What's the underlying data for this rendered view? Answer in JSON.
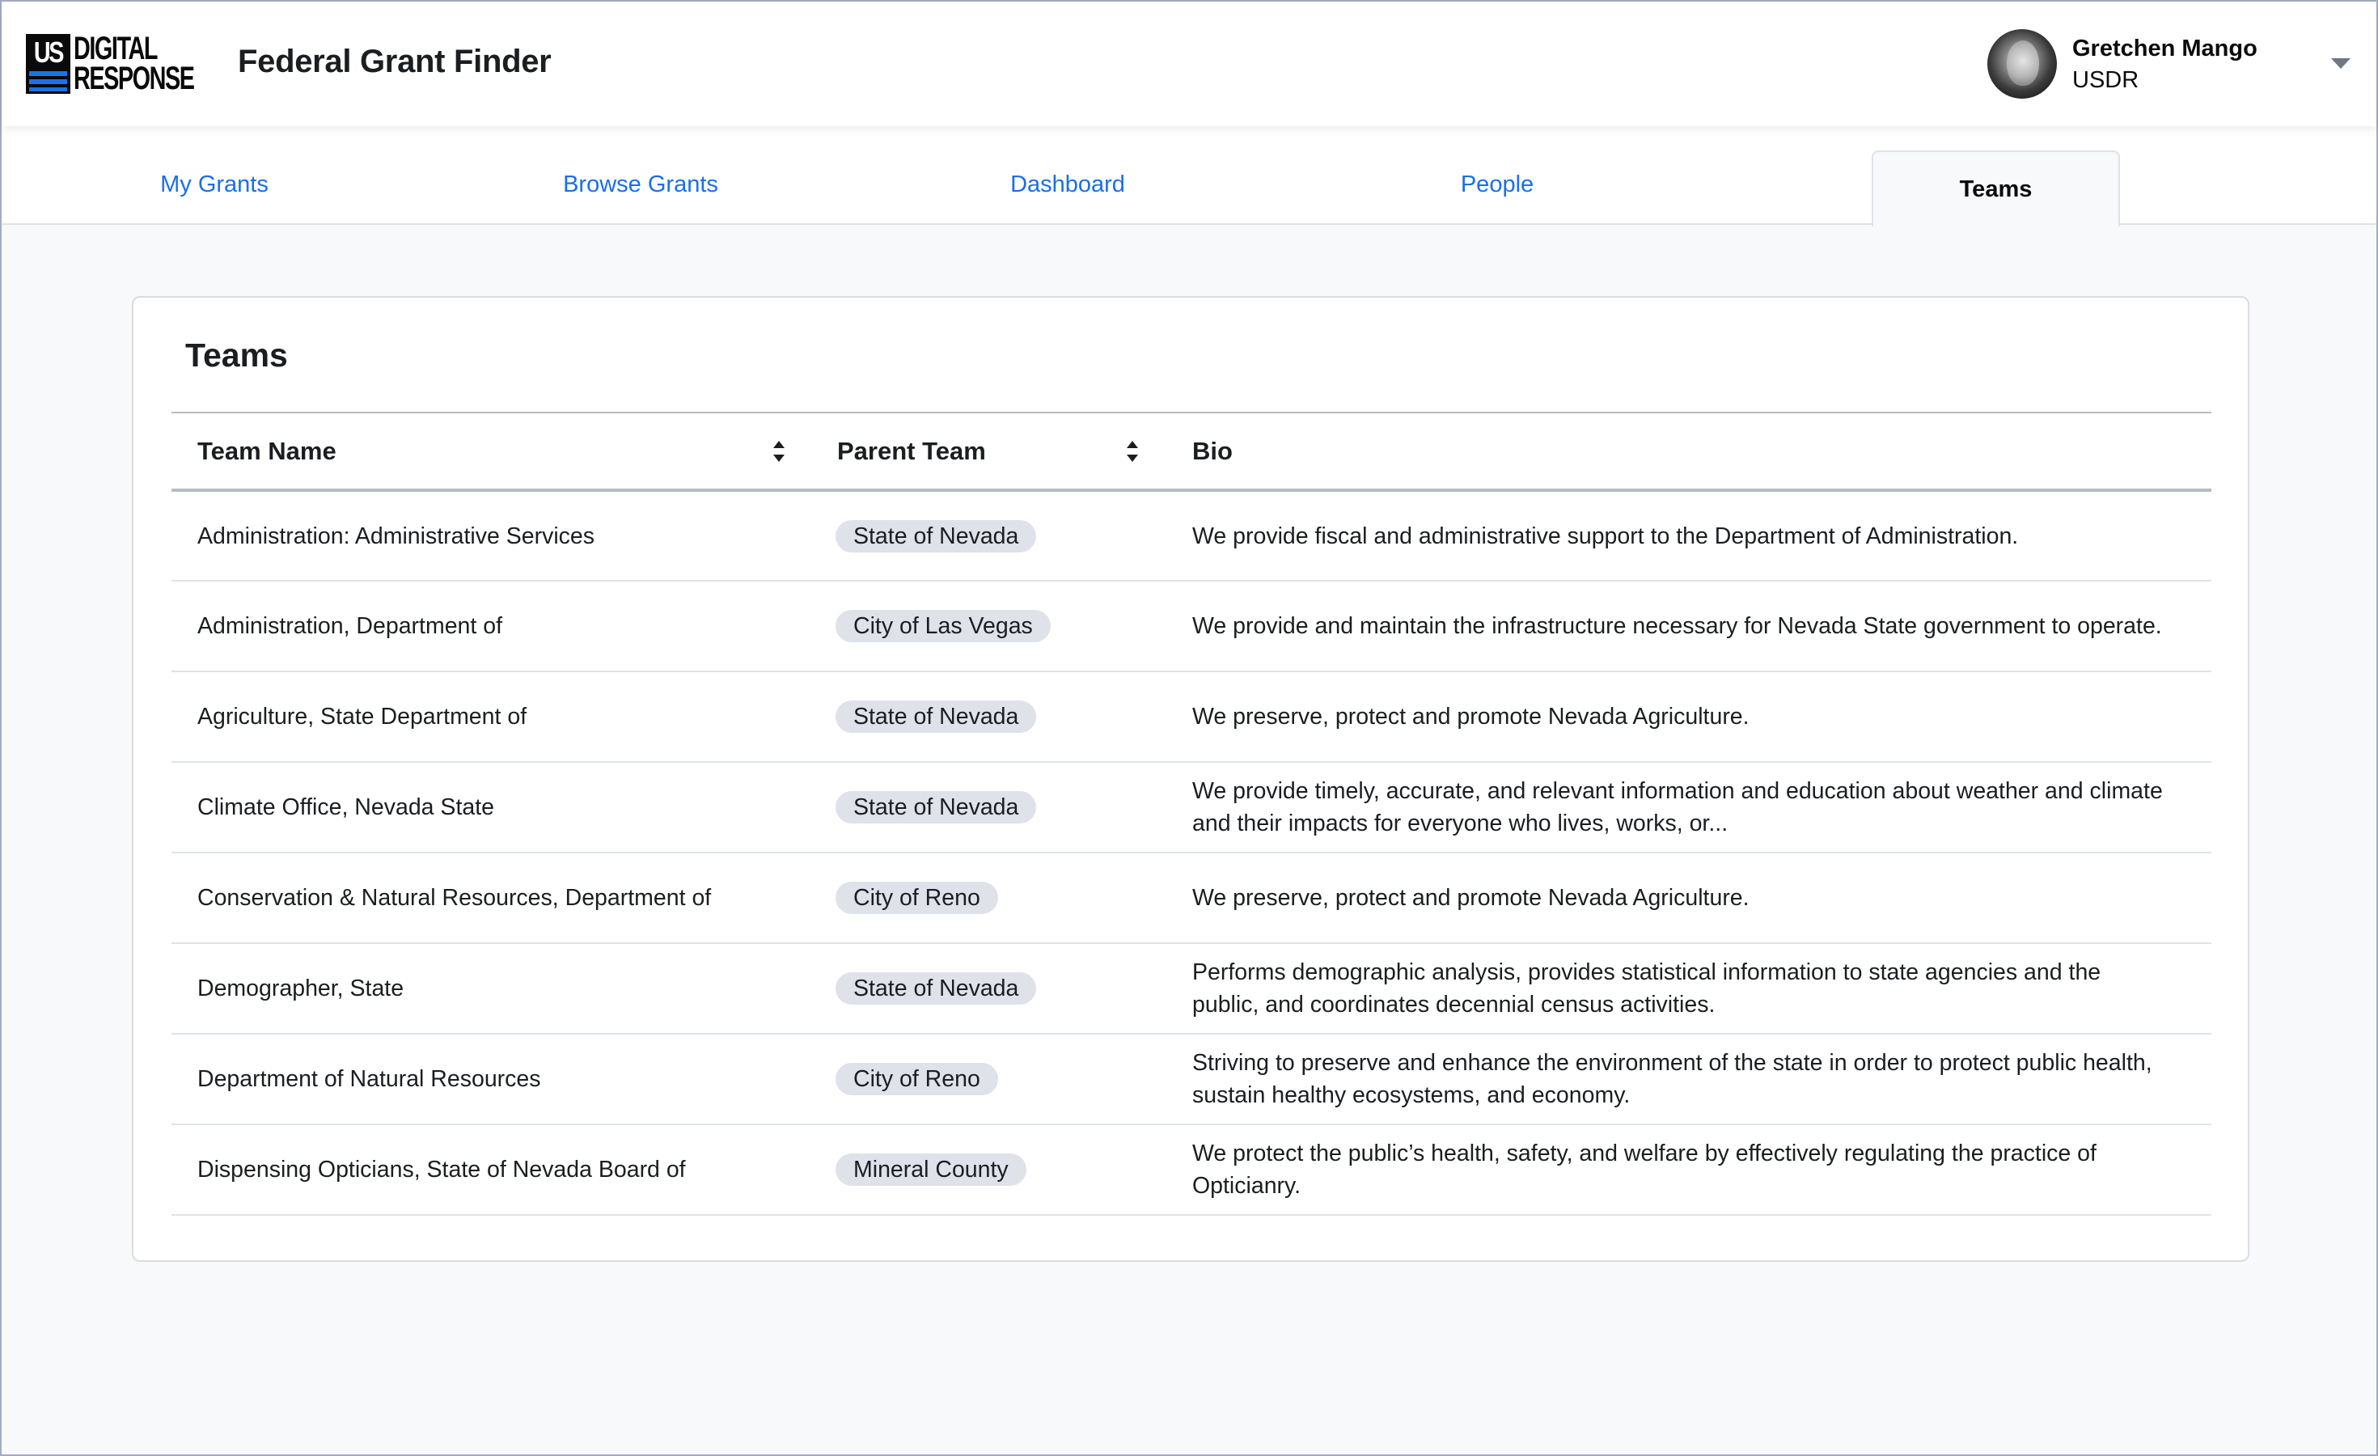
{
  "header": {
    "logo": {
      "us": "US",
      "line1": "DIGITAL",
      "line2": "RESPONSE"
    },
    "app_title": "Federal Grant Finder",
    "user": {
      "name": "Gretchen Mango",
      "organization": "USDR"
    }
  },
  "nav": {
    "tabs": [
      {
        "label": "My Grants",
        "active": false
      },
      {
        "label": "Browse Grants",
        "active": false
      },
      {
        "label": "Dashboard",
        "active": false
      },
      {
        "label": "People",
        "active": false
      },
      {
        "label": "Teams",
        "active": true
      }
    ]
  },
  "colors": {
    "link": "#1a6fe8",
    "badge_bg": "#dfe2e8",
    "logo_stripe": "#1a73e8"
  },
  "teams_card": {
    "title": "Teams",
    "columns": [
      {
        "label": "Team Name",
        "sortable": true
      },
      {
        "label": "Parent Team",
        "sortable": true
      },
      {
        "label": "Bio",
        "sortable": false
      }
    ],
    "rows": [
      {
        "team_name": "Administration: Administrative Services",
        "parent_team": "State of Nevada",
        "bio": "We provide fiscal and administrative support to the Department of Administration."
      },
      {
        "team_name": "Administration, Department of",
        "parent_team": "City of Las Vegas",
        "bio": "We provide and maintain the infrastructure necessary for Nevada State government to operate."
      },
      {
        "team_name": "Agriculture, State Department of",
        "parent_team": "State of Nevada",
        "bio": "We preserve, protect and promote Nevada Agriculture."
      },
      {
        "team_name": "Climate Office, Nevada State",
        "parent_team": "State of Nevada",
        "bio": "We provide timely, accurate, and relevant information and education about weather and climate and their impacts for everyone who lives, works, or..."
      },
      {
        "team_name": "Conservation & Natural Resources, Department of",
        "parent_team": "City of Reno",
        "bio": "We preserve, protect and promote Nevada Agriculture."
      },
      {
        "team_name": "Demographer, State",
        "parent_team": "State of Nevada",
        "bio": "Performs demographic analysis, provides statistical information to state agencies and the public, and coordinates decennial census activities."
      },
      {
        "team_name": "Department of Natural Resources",
        "parent_team": "City of Reno",
        "bio": "Striving to preserve and enhance the environment of the state in order to protect public health, sustain healthy ecosystems, and economy."
      },
      {
        "team_name": "Dispensing Opticians, State of Nevada Board of",
        "parent_team": "Mineral County",
        "bio": "We protect the public’s health, safety, and welfare by effectively regulating the practice  of Opticianry."
      }
    ]
  }
}
